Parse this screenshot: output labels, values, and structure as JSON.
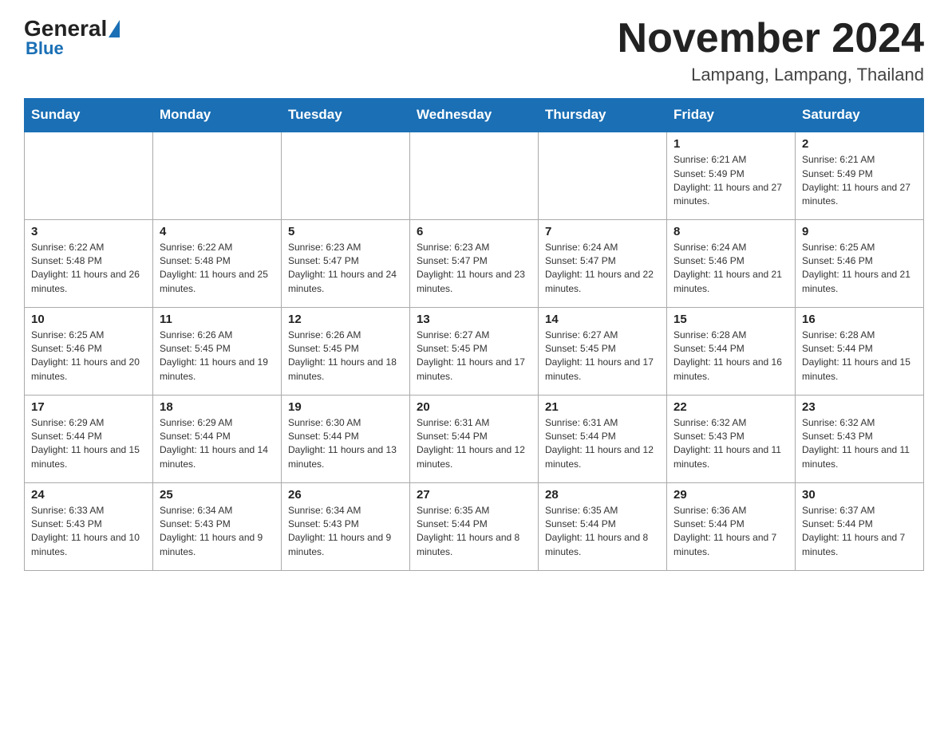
{
  "logo": {
    "general": "General",
    "blue": "Blue"
  },
  "header": {
    "month": "November 2024",
    "location": "Lampang, Lampang, Thailand"
  },
  "days_of_week": [
    "Sunday",
    "Monday",
    "Tuesday",
    "Wednesday",
    "Thursday",
    "Friday",
    "Saturday"
  ],
  "weeks": [
    [
      {
        "day": "",
        "info": ""
      },
      {
        "day": "",
        "info": ""
      },
      {
        "day": "",
        "info": ""
      },
      {
        "day": "",
        "info": ""
      },
      {
        "day": "",
        "info": ""
      },
      {
        "day": "1",
        "info": "Sunrise: 6:21 AM\nSunset: 5:49 PM\nDaylight: 11 hours and 27 minutes."
      },
      {
        "day": "2",
        "info": "Sunrise: 6:21 AM\nSunset: 5:49 PM\nDaylight: 11 hours and 27 minutes."
      }
    ],
    [
      {
        "day": "3",
        "info": "Sunrise: 6:22 AM\nSunset: 5:48 PM\nDaylight: 11 hours and 26 minutes."
      },
      {
        "day": "4",
        "info": "Sunrise: 6:22 AM\nSunset: 5:48 PM\nDaylight: 11 hours and 25 minutes."
      },
      {
        "day": "5",
        "info": "Sunrise: 6:23 AM\nSunset: 5:47 PM\nDaylight: 11 hours and 24 minutes."
      },
      {
        "day": "6",
        "info": "Sunrise: 6:23 AM\nSunset: 5:47 PM\nDaylight: 11 hours and 23 minutes."
      },
      {
        "day": "7",
        "info": "Sunrise: 6:24 AM\nSunset: 5:47 PM\nDaylight: 11 hours and 22 minutes."
      },
      {
        "day": "8",
        "info": "Sunrise: 6:24 AM\nSunset: 5:46 PM\nDaylight: 11 hours and 21 minutes."
      },
      {
        "day": "9",
        "info": "Sunrise: 6:25 AM\nSunset: 5:46 PM\nDaylight: 11 hours and 21 minutes."
      }
    ],
    [
      {
        "day": "10",
        "info": "Sunrise: 6:25 AM\nSunset: 5:46 PM\nDaylight: 11 hours and 20 minutes."
      },
      {
        "day": "11",
        "info": "Sunrise: 6:26 AM\nSunset: 5:45 PM\nDaylight: 11 hours and 19 minutes."
      },
      {
        "day": "12",
        "info": "Sunrise: 6:26 AM\nSunset: 5:45 PM\nDaylight: 11 hours and 18 minutes."
      },
      {
        "day": "13",
        "info": "Sunrise: 6:27 AM\nSunset: 5:45 PM\nDaylight: 11 hours and 17 minutes."
      },
      {
        "day": "14",
        "info": "Sunrise: 6:27 AM\nSunset: 5:45 PM\nDaylight: 11 hours and 17 minutes."
      },
      {
        "day": "15",
        "info": "Sunrise: 6:28 AM\nSunset: 5:44 PM\nDaylight: 11 hours and 16 minutes."
      },
      {
        "day": "16",
        "info": "Sunrise: 6:28 AM\nSunset: 5:44 PM\nDaylight: 11 hours and 15 minutes."
      }
    ],
    [
      {
        "day": "17",
        "info": "Sunrise: 6:29 AM\nSunset: 5:44 PM\nDaylight: 11 hours and 15 minutes."
      },
      {
        "day": "18",
        "info": "Sunrise: 6:29 AM\nSunset: 5:44 PM\nDaylight: 11 hours and 14 minutes."
      },
      {
        "day": "19",
        "info": "Sunrise: 6:30 AM\nSunset: 5:44 PM\nDaylight: 11 hours and 13 minutes."
      },
      {
        "day": "20",
        "info": "Sunrise: 6:31 AM\nSunset: 5:44 PM\nDaylight: 11 hours and 12 minutes."
      },
      {
        "day": "21",
        "info": "Sunrise: 6:31 AM\nSunset: 5:44 PM\nDaylight: 11 hours and 12 minutes."
      },
      {
        "day": "22",
        "info": "Sunrise: 6:32 AM\nSunset: 5:43 PM\nDaylight: 11 hours and 11 minutes."
      },
      {
        "day": "23",
        "info": "Sunrise: 6:32 AM\nSunset: 5:43 PM\nDaylight: 11 hours and 11 minutes."
      }
    ],
    [
      {
        "day": "24",
        "info": "Sunrise: 6:33 AM\nSunset: 5:43 PM\nDaylight: 11 hours and 10 minutes."
      },
      {
        "day": "25",
        "info": "Sunrise: 6:34 AM\nSunset: 5:43 PM\nDaylight: 11 hours and 9 minutes."
      },
      {
        "day": "26",
        "info": "Sunrise: 6:34 AM\nSunset: 5:43 PM\nDaylight: 11 hours and 9 minutes."
      },
      {
        "day": "27",
        "info": "Sunrise: 6:35 AM\nSunset: 5:44 PM\nDaylight: 11 hours and 8 minutes."
      },
      {
        "day": "28",
        "info": "Sunrise: 6:35 AM\nSunset: 5:44 PM\nDaylight: 11 hours and 8 minutes."
      },
      {
        "day": "29",
        "info": "Sunrise: 6:36 AM\nSunset: 5:44 PM\nDaylight: 11 hours and 7 minutes."
      },
      {
        "day": "30",
        "info": "Sunrise: 6:37 AM\nSunset: 5:44 PM\nDaylight: 11 hours and 7 minutes."
      }
    ]
  ]
}
